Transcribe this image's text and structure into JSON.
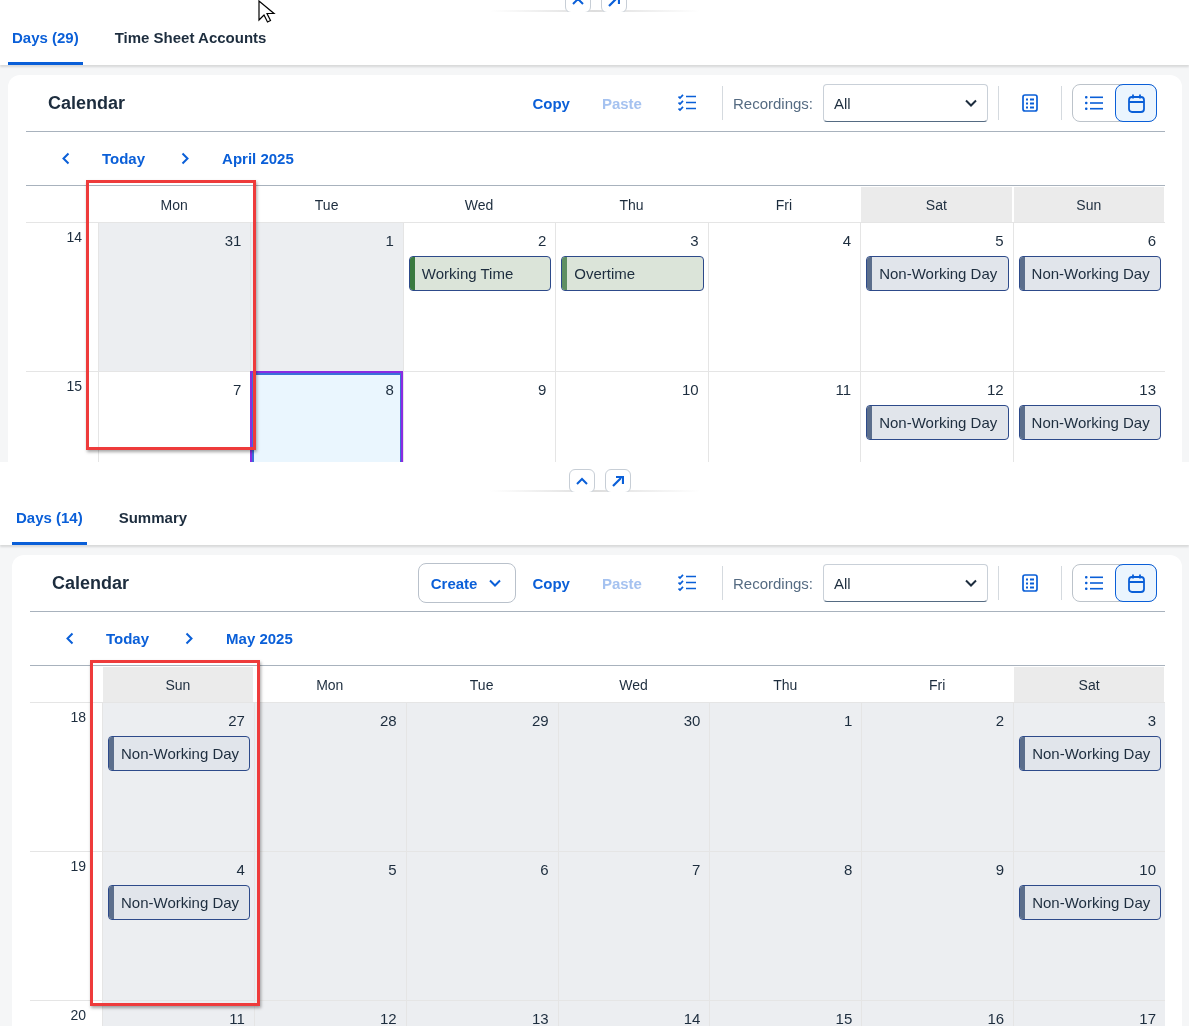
{
  "panels": [
    {
      "tabs": [
        {
          "label": "Days (29)",
          "selected": true
        },
        {
          "label": "Time Sheet Accounts",
          "selected": false
        }
      ],
      "title": "Calendar",
      "actions": [
        {
          "kind": "text",
          "label": "Copy",
          "disabled": false
        },
        {
          "kind": "text",
          "label": "Paste",
          "disabled": true
        }
      ],
      "recordings": {
        "label": "Recordings:",
        "value": "All"
      },
      "views": [
        {
          "kind": "list",
          "selected": false
        },
        {
          "kind": "calendar",
          "selected": true
        }
      ],
      "nav": {
        "today": "Today",
        "period": "April 2025"
      },
      "weekdays": [
        {
          "label": "Mon",
          "weekend": false,
          "highlighted": true
        },
        {
          "label": "Tue",
          "weekend": false,
          "highlighted": false
        },
        {
          "label": "Wed",
          "weekend": false,
          "highlighted": false
        },
        {
          "label": "Thu",
          "weekend": false,
          "highlighted": false
        },
        {
          "label": "Fri",
          "weekend": false,
          "highlighted": false
        },
        {
          "label": "Sat",
          "weekend": true,
          "highlighted": false
        },
        {
          "label": "Sun",
          "weekend": true,
          "highlighted": false
        }
      ],
      "weeks": [
        {
          "number": "14",
          "days": [
            {
              "day": "31",
              "dimmed": true,
              "selected": false
            },
            {
              "day": "1",
              "dimmed": true,
              "selected": false
            },
            {
              "day": "2",
              "dimmed": false,
              "selected": false,
              "events": [
                {
                  "kind": "working",
                  "label": "Working Time",
                  "color": "#3a7a3f"
                }
              ]
            },
            {
              "day": "3",
              "dimmed": false,
              "selected": false,
              "events": [
                {
                  "kind": "working",
                  "label": "Overtime",
                  "color": "#5f8f63"
                }
              ]
            },
            {
              "day": "4",
              "dimmed": false,
              "selected": false
            },
            {
              "day": "5",
              "dimmed": false,
              "selected": false,
              "events": [
                {
                  "kind": "non-working",
                  "label": "Non-Working Day",
                  "color": "#5b6e8c"
                }
              ]
            },
            {
              "day": "6",
              "dimmed": false,
              "selected": false,
              "events": [
                {
                  "kind": "non-working",
                  "label": "Non-Working Day",
                  "color": "#5b6e8c"
                }
              ]
            }
          ]
        },
        {
          "number": "15",
          "days": [
            {
              "day": "7",
              "dimmed": false,
              "selected": false
            },
            {
              "day": "8",
              "dimmed": false,
              "selected": true
            },
            {
              "day": "9",
              "dimmed": false,
              "selected": false
            },
            {
              "day": "10",
              "dimmed": false,
              "selected": false
            },
            {
              "day": "11",
              "dimmed": false,
              "selected": false
            },
            {
              "day": "12",
              "dimmed": false,
              "selected": false,
              "events": [
                {
                  "kind": "non-working",
                  "label": "Non-Working Day",
                  "color": "#5b6e8c"
                }
              ]
            },
            {
              "day": "13",
              "dimmed": false,
              "selected": false,
              "events": [
                {
                  "kind": "non-working",
                  "label": "Non-Working Day",
                  "color": "#5b6e8c"
                }
              ]
            }
          ]
        }
      ]
    },
    {
      "tabs": [
        {
          "label": "Days (14)",
          "selected": true
        },
        {
          "label": "Summary",
          "selected": false
        }
      ],
      "title": "Calendar",
      "actions": [
        {
          "kind": "menu",
          "label": "Create",
          "disabled": false
        },
        {
          "kind": "text",
          "label": "Copy",
          "disabled": false
        },
        {
          "kind": "text",
          "label": "Paste",
          "disabled": true
        }
      ],
      "recordings": {
        "label": "Recordings:",
        "value": "All"
      },
      "views": [
        {
          "kind": "list",
          "selected": false
        },
        {
          "kind": "calendar",
          "selected": true
        }
      ],
      "nav": {
        "today": "Today",
        "period": "May 2025"
      },
      "weekdays": [
        {
          "label": "Sun",
          "weekend": true,
          "highlighted": true
        },
        {
          "label": "Mon",
          "weekend": false,
          "highlighted": false
        },
        {
          "label": "Tue",
          "weekend": false,
          "highlighted": false
        },
        {
          "label": "Wed",
          "weekend": false,
          "highlighted": false
        },
        {
          "label": "Thu",
          "weekend": false,
          "highlighted": false
        },
        {
          "label": "Fri",
          "weekend": false,
          "highlighted": false
        },
        {
          "label": "Sat",
          "weekend": true,
          "highlighted": false
        }
      ],
      "weeks": [
        {
          "number": "18",
          "days": [
            {
              "day": "27",
              "dimmed": true,
              "selected": false,
              "events": [
                {
                  "kind": "non-working",
                  "label": "Non-Working Day",
                  "color": "#5b6e8c"
                }
              ]
            },
            {
              "day": "28",
              "dimmed": true,
              "selected": false
            },
            {
              "day": "29",
              "dimmed": true,
              "selected": false
            },
            {
              "day": "30",
              "dimmed": true,
              "selected": false
            },
            {
              "day": "1",
              "dimmed": true,
              "selected": false
            },
            {
              "day": "2",
              "dimmed": true,
              "selected": false
            },
            {
              "day": "3",
              "dimmed": true,
              "selected": false,
              "events": [
                {
                  "kind": "non-working",
                  "label": "Non-Working Day",
                  "color": "#5b6e8c"
                }
              ]
            }
          ]
        },
        {
          "number": "19",
          "days": [
            {
              "day": "4",
              "dimmed": true,
              "selected": false,
              "events": [
                {
                  "kind": "non-working",
                  "label": "Non-Working Day",
                  "color": "#5b6e8c"
                }
              ]
            },
            {
              "day": "5",
              "dimmed": true,
              "selected": false
            },
            {
              "day": "6",
              "dimmed": true,
              "selected": false
            },
            {
              "day": "7",
              "dimmed": true,
              "selected": false
            },
            {
              "day": "8",
              "dimmed": true,
              "selected": false
            },
            {
              "day": "9",
              "dimmed": true,
              "selected": false
            },
            {
              "day": "10",
              "dimmed": true,
              "selected": false,
              "events": [
                {
                  "kind": "non-working",
                  "label": "Non-Working Day",
                  "color": "#5b6e8c"
                }
              ]
            }
          ]
        },
        {
          "number": "20",
          "days": [
            {
              "day": "11",
              "dimmed": true,
              "selected": false
            },
            {
              "day": "12",
              "dimmed": true,
              "selected": false
            },
            {
              "day": "13",
              "dimmed": true,
              "selected": false
            },
            {
              "day": "14",
              "dimmed": true,
              "selected": false
            },
            {
              "day": "15",
              "dimmed": true,
              "selected": false
            },
            {
              "day": "16",
              "dimmed": true,
              "selected": false
            },
            {
              "day": "17",
              "dimmed": true,
              "selected": false
            }
          ]
        }
      ]
    }
  ]
}
